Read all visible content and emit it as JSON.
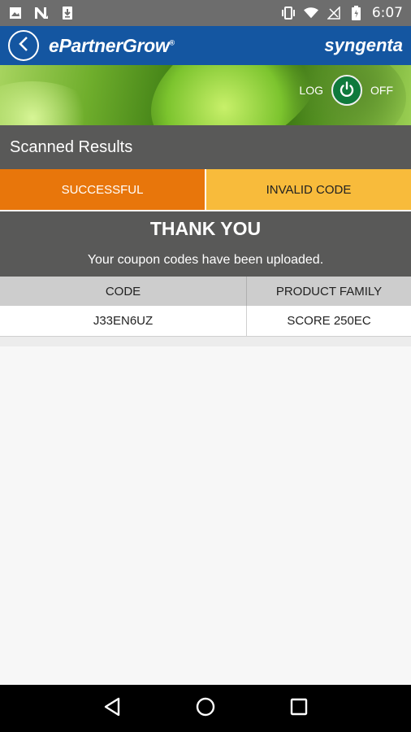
{
  "status_bar": {
    "time": "6:07",
    "icons": [
      "image-icon",
      "n-icon",
      "download-icon",
      "vibrate-icon",
      "wifi-icon",
      "signal-icon",
      "battery-icon"
    ]
  },
  "header": {
    "brand": "ePartnerGrow",
    "brand_mark": "®",
    "logo": "syngenta"
  },
  "banner": {
    "logout_left": "LOG",
    "logout_right": "OFF"
  },
  "section_title": "Scanned Results",
  "tabs": [
    {
      "label": "SUCCESSFUL",
      "color": "#e8760b",
      "selected": true
    },
    {
      "label": "INVALID CODE",
      "color": "#f8bb3b",
      "selected": false
    }
  ],
  "thanks": {
    "title": "THANK YOU",
    "message": "Your coupon codes have been uploaded."
  },
  "table": {
    "columns": [
      "CODE",
      "PRODUCT FAMILY"
    ],
    "rows": [
      [
        "J33EN6UZ",
        "SCORE 250EC"
      ]
    ]
  },
  "colors": {
    "header_blue": "#1456a1",
    "panel_gray": "#595958",
    "accent_green": "#0f7a3c"
  }
}
